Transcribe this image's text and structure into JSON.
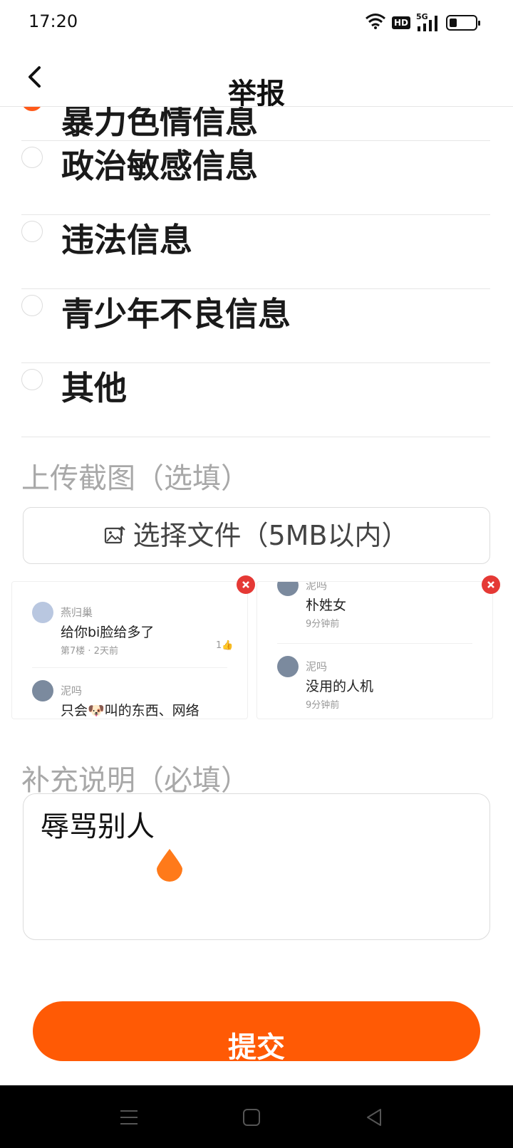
{
  "status_bar": {
    "time": "17:20",
    "network_badge": "HD",
    "network_type": "5G",
    "battery_level": 0.3
  },
  "header": {
    "title": "举报",
    "back_icon": "chevron-left-icon"
  },
  "options": [
    {
      "label": "暴力色情信息",
      "checked": true
    },
    {
      "label": "政治敏感信息",
      "checked": false
    },
    {
      "label": "违法信息",
      "checked": false
    },
    {
      "label": "青少年不良信息",
      "checked": false
    },
    {
      "label": "其他",
      "checked": false
    }
  ],
  "upload": {
    "label": "上传截图（选填）",
    "button_label": "选择文件（5MB以内）",
    "button_icon": "image-upload-icon"
  },
  "screenshots": [
    {
      "comments": [
        {
          "name": "燕归巢",
          "text": "给你bi脸给多了",
          "meta": "第7楼 · 2天前",
          "likes": "1"
        },
        {
          "name": "泥吗",
          "text": "只会🐶叫的东西、网络",
          "meta": "",
          "likes": ""
        }
      ]
    },
    {
      "comments": [
        {
          "name": "泥吗",
          "text": "朴姓女",
          "meta": "9分钟前",
          "likes": ""
        },
        {
          "name": "泥吗",
          "text": "没用的人机",
          "meta": "9分钟前",
          "likes": ""
        }
      ]
    }
  ],
  "description": {
    "label": "补充说明（必填）",
    "value": "辱骂别人"
  },
  "submit": {
    "label": "提交"
  },
  "colors": {
    "accent": "#ff5a05",
    "remove": "#e53935",
    "label_gray": "#a8a8a8"
  }
}
